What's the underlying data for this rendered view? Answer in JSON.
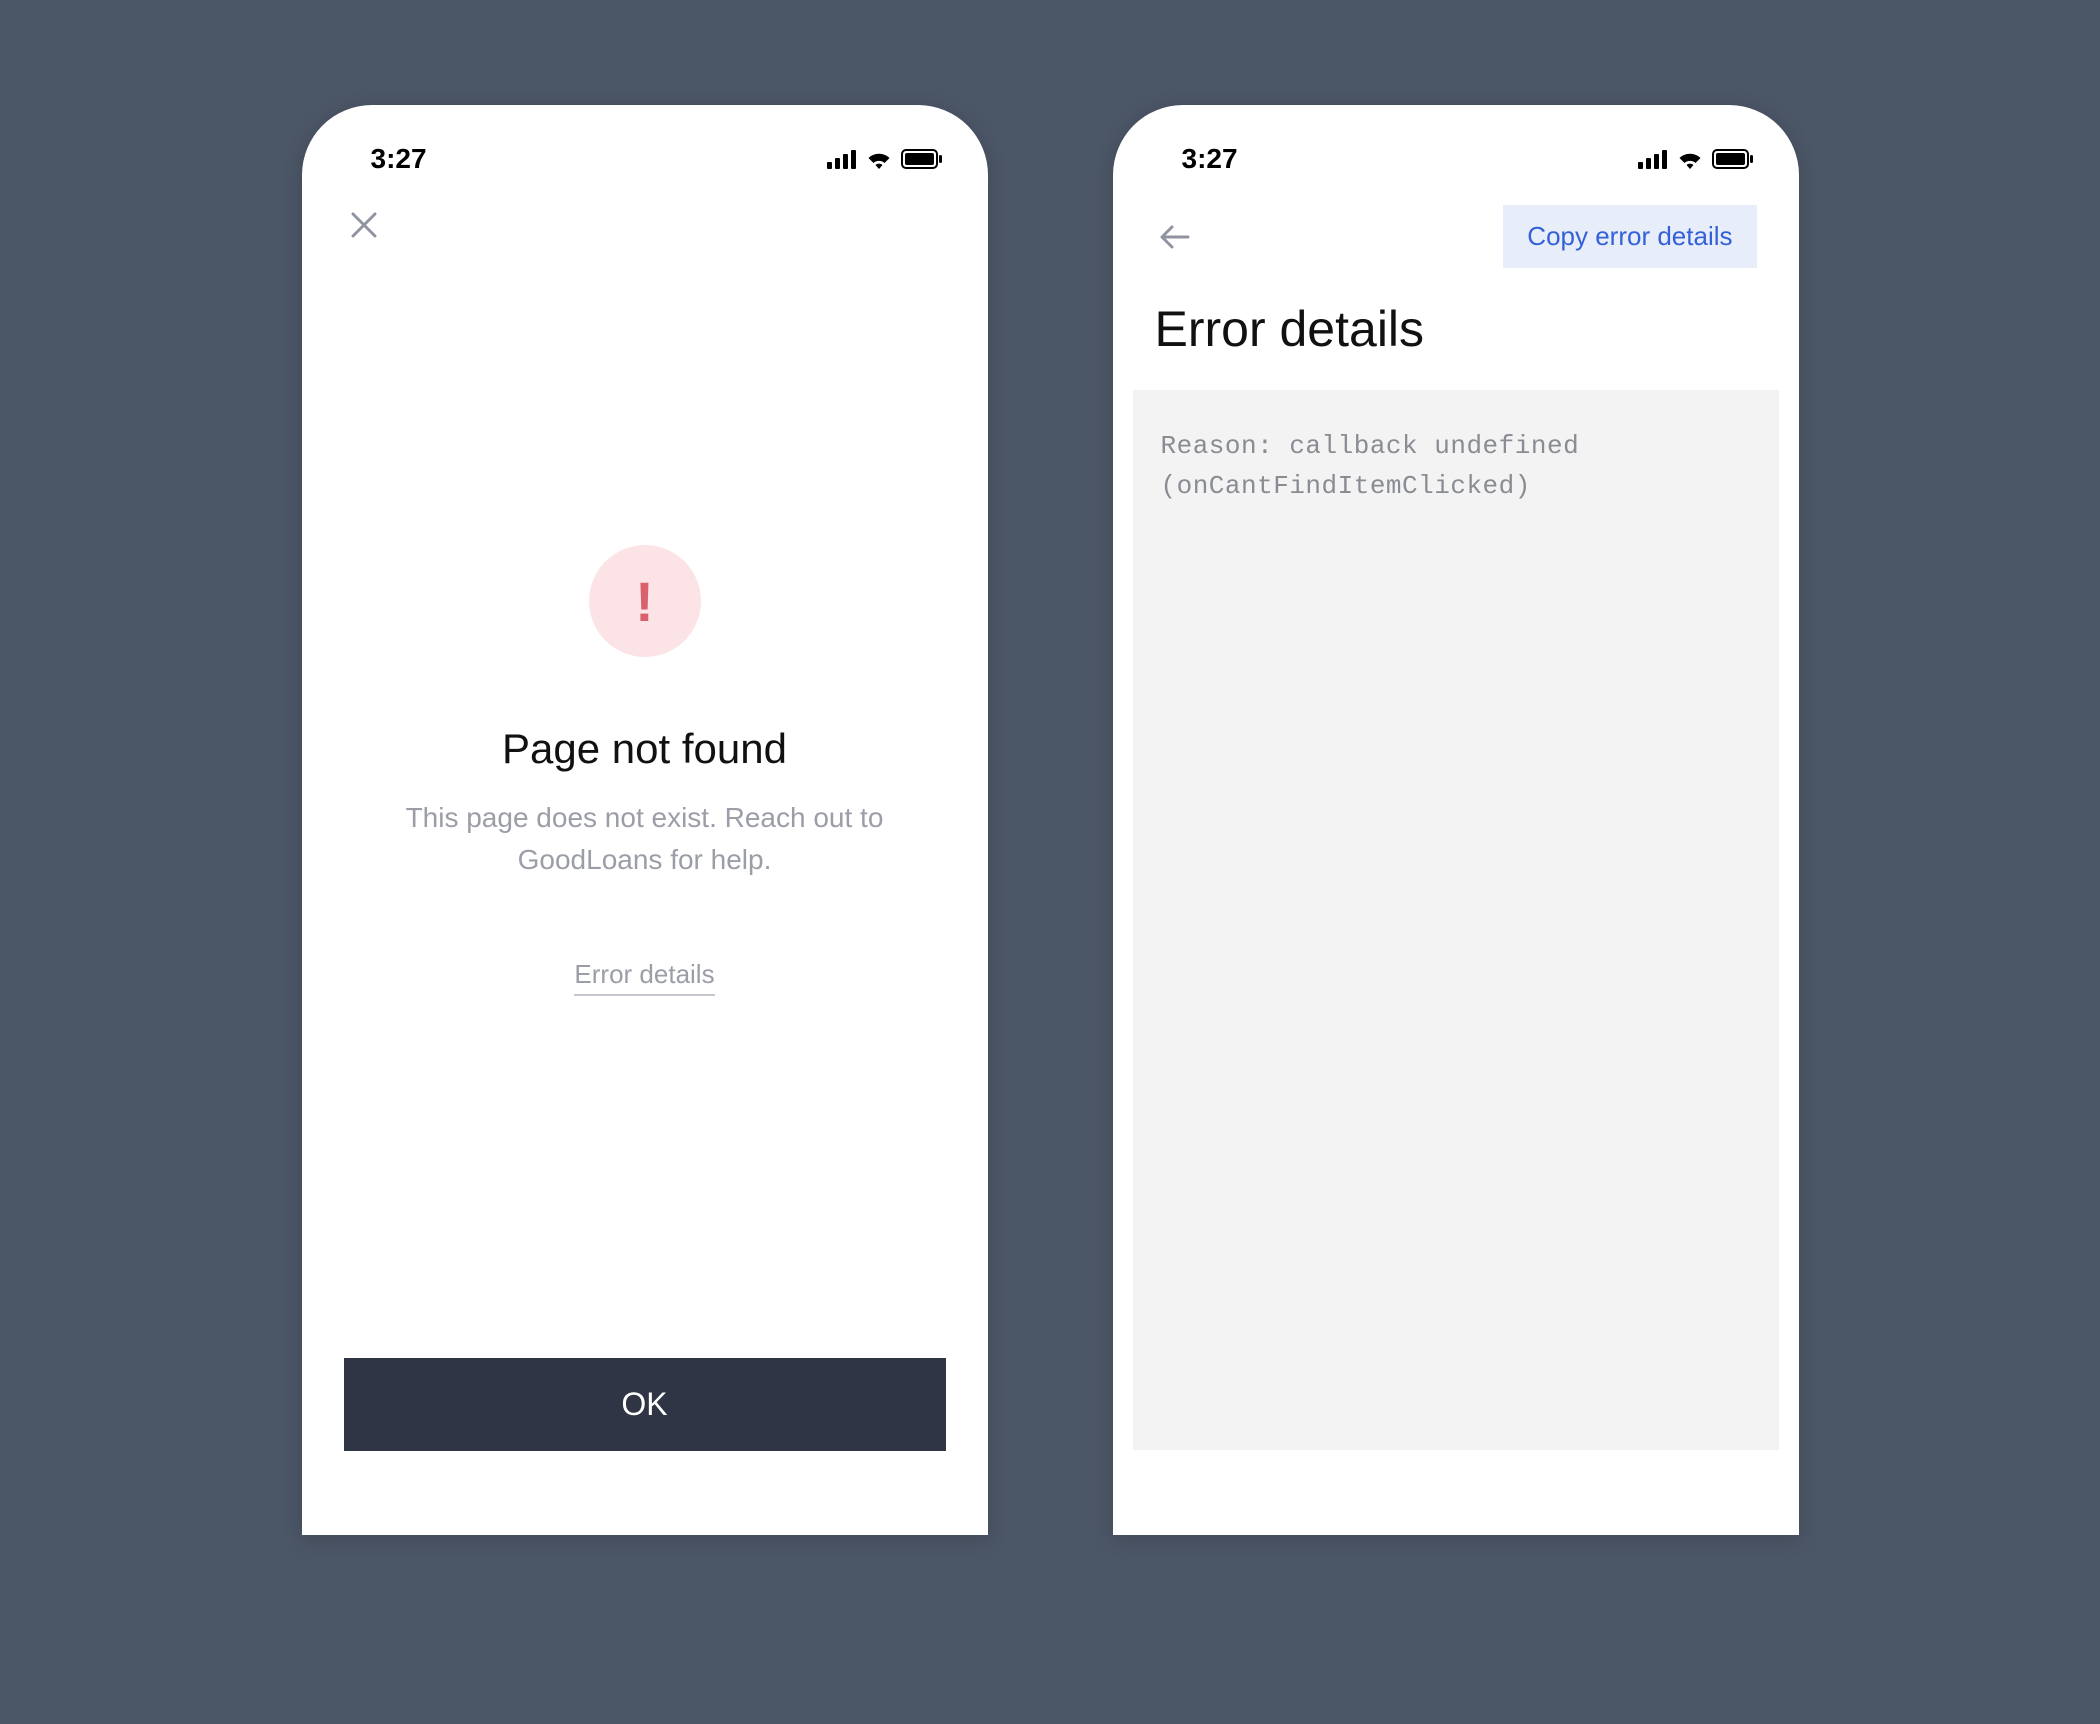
{
  "status_bar": {
    "time": "3:27"
  },
  "screen_error": {
    "title": "Page not found",
    "subtitle": "This page does not exist. Reach out to GoodLoans for help.",
    "details_link_label": "Error details",
    "ok_button_label": "OK",
    "icon_glyph": "!"
  },
  "screen_details": {
    "title": "Error details",
    "copy_button_label": "Copy error details",
    "log_text": "Reason: callback undefined (onCantFindItemClicked)"
  }
}
